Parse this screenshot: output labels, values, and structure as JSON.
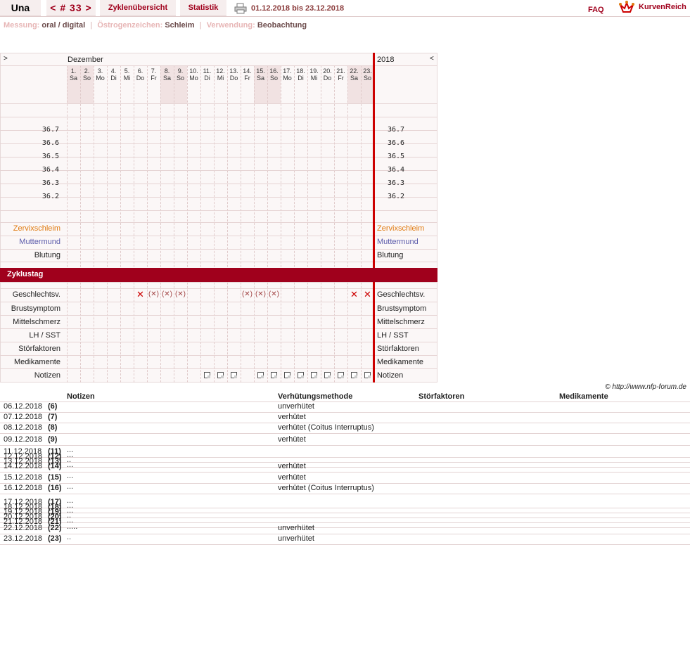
{
  "header": {
    "name": "Una",
    "cycle": "< # 33 >",
    "tab_overview": "Zyklenübersicht",
    "tab_stats": "Statistik",
    "date_range": "01.12.2018 bis 23.12.2018",
    "faq": "FAQ",
    "brand": "KurvenReich"
  },
  "settings": {
    "measure_label": "Messung:",
    "measure_value": "oral / digital",
    "estrogen_label": "Östrogenzeichen:",
    "estrogen_value": "Schleim",
    "use_label": "Verwendung:",
    "use_value": "Beobachtung"
  },
  "chart": {
    "nav_left": ">",
    "nav_right": "<",
    "month": "Dezember",
    "year": "2018",
    "days": [
      {
        "d": "1.",
        "w": "Sa"
      },
      {
        "d": "2.",
        "w": "So"
      },
      {
        "d": "3.",
        "w": "Mo"
      },
      {
        "d": "4.",
        "w": "Di"
      },
      {
        "d": "5.",
        "w": "Mi"
      },
      {
        "d": "6.",
        "w": "Do"
      },
      {
        "d": "7.",
        "w": "Fr"
      },
      {
        "d": "8.",
        "w": "Sa"
      },
      {
        "d": "9.",
        "w": "So"
      },
      {
        "d": "10.",
        "w": "Mo"
      },
      {
        "d": "11.",
        "w": "Di"
      },
      {
        "d": "12.",
        "w": "Mi"
      },
      {
        "d": "13.",
        "w": "Do"
      },
      {
        "d": "14.",
        "w": "Fr"
      },
      {
        "d": "15.",
        "w": "Sa"
      },
      {
        "d": "16.",
        "w": "So"
      },
      {
        "d": "17.",
        "w": "Mo"
      },
      {
        "d": "18.",
        "w": "Di"
      },
      {
        "d": "19.",
        "w": "Mi"
      },
      {
        "d": "20.",
        "w": "Do"
      },
      {
        "d": "21.",
        "w": "Fr"
      },
      {
        "d": "22.",
        "w": "Sa"
      },
      {
        "d": "23.",
        "w": "So"
      }
    ],
    "temps": [
      "36.7",
      "36.6",
      "36.5",
      "36.4",
      "36.3",
      "36.2"
    ],
    "rows": {
      "cervix": "Zervixschleim",
      "cervix_pos": "Muttermund",
      "bleeding": "Blutung",
      "cycle_day": "Zyklustag",
      "sex": "Geschlechtsv.",
      "breast": "Brustsymptom",
      "midpain": "Mittelschmerz",
      "lh": "LH / SST",
      "disturb": "Störfaktoren",
      "meds": "Medikamente",
      "notes": "Notizen"
    },
    "cycle_days": [
      "1",
      "2",
      "3",
      "4",
      "5",
      "6",
      "7",
      "8",
      "9",
      "10",
      "11",
      "12",
      "13",
      "14",
      "15",
      "16",
      "17",
      "18",
      "19",
      "20",
      "21",
      "22",
      "23"
    ],
    "sex_marks": {
      "6": "✕",
      "7": "(✕)",
      "8": "(✕)",
      "9": "(✕)",
      "14": "(✕)",
      "15": "(✕)",
      "16": "(✕)",
      "22": "✕",
      "23": "✕"
    },
    "note_days": [
      11,
      12,
      13,
      15,
      16,
      17,
      18,
      19,
      20,
      21,
      22,
      23
    ],
    "colors": {
      "accent": "#a0001c",
      "cervix": "#e07a10",
      "cervix_pos": "#5a5aaa",
      "line": "#cc0000"
    }
  },
  "copyright": "© http://www.nfp-forum.de",
  "table": {
    "headers": {
      "notes": "Notizen",
      "method": "Verhütungsmethode",
      "disturb": "Störfaktoren",
      "meds": "Medikamente"
    },
    "rows": [
      {
        "date": "06.12.2018",
        "day": "(6)",
        "note": "",
        "method": "unverhütet"
      },
      {
        "date": "07.12.2018",
        "day": "(7)",
        "note": "",
        "method": "verhütet"
      },
      {
        "date": "08.12.2018",
        "day": "(8)",
        "note": "",
        "method": "verhütet (Coitus Interruptus)"
      },
      {
        "date": "09.12.2018",
        "day": "(9)",
        "note": "",
        "method": "verhütet"
      },
      {
        "date": "11.12.2018",
        "day": "(11)",
        "note": "...",
        "method": ""
      },
      {
        "date": "12.12.2018",
        "day": "(12)",
        "note": "...",
        "method": ""
      },
      {
        "date": "13.12.2018",
        "day": "(13)",
        "note": "..",
        "method": ""
      },
      {
        "date": "14.12.2018",
        "day": "(14)",
        "note": "...",
        "method": "verhütet"
      },
      {
        "date": "15.12.2018",
        "day": "(15)",
        "note": "...",
        "method": "verhütet"
      },
      {
        "date": "16.12.2018",
        "day": "(16)",
        "note": "...",
        "method": "verhütet (Coitus Interruptus)"
      },
      {
        "date": "17.12.2018",
        "day": "(17)",
        "note": "...",
        "method": ""
      },
      {
        "date": "18.12.2018",
        "day": "(18)",
        "note": "...",
        "method": ""
      },
      {
        "date": "19.12.2018",
        "day": "(19)",
        "note": "...",
        "method": ""
      },
      {
        "date": "20.12.2018",
        "day": "(20)",
        "note": "..",
        "method": ""
      },
      {
        "date": "21.12.2018",
        "day": "(21)",
        "note": "...",
        "method": ""
      },
      {
        "date": "22.12.2018",
        "day": "(22)",
        "note": ".....",
        "method": "unverhütet"
      },
      {
        "date": "23.12.2018",
        "day": "(23)",
        "note": "..",
        "method": "unverhütet"
      }
    ]
  }
}
